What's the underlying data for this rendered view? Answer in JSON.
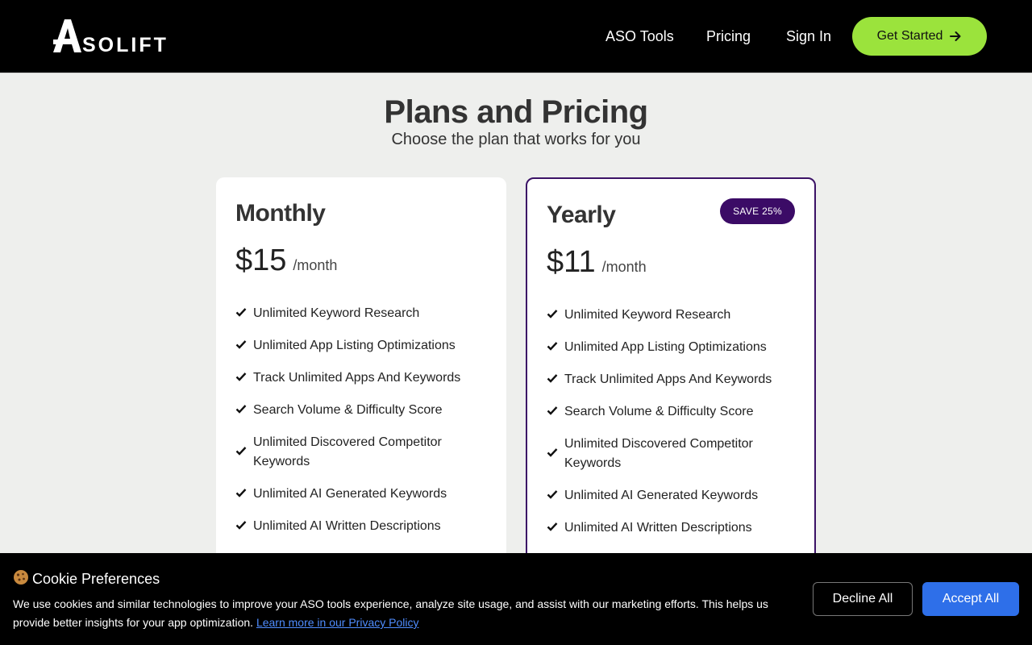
{
  "header": {
    "logo_text": "SOLIFT",
    "nav": [
      {
        "label": "ASO Tools"
      },
      {
        "label": "Pricing"
      },
      {
        "label": "Sign In"
      }
    ],
    "cta_label": "Get Started",
    "cta_icon": "arrow-right-icon"
  },
  "hero": {
    "title": "Plans and Pricing",
    "subtitle": "Choose the plan that works for you"
  },
  "plans": [
    {
      "name": "Monthly",
      "price": "$15",
      "unit": "/month",
      "badge": "",
      "features": [
        "Unlimited Keyword Research",
        "Unlimited App Listing Optimizations",
        "Track Unlimited Apps And Keywords",
        "Search Volume & Difficulty Score",
        "Unlimited Discovered Competitor Keywords",
        "Unlimited AI Generated Keywords",
        "Unlimited AI Written Descriptions"
      ]
    },
    {
      "name": "Yearly",
      "price": "$11",
      "unit": "/month",
      "badge": "SAVE 25%",
      "features": [
        "Unlimited Keyword Research",
        "Unlimited App Listing Optimizations",
        "Track Unlimited Apps And Keywords",
        "Search Volume & Difficulty Score",
        "Unlimited Discovered Competitor Keywords",
        "Unlimited AI Generated Keywords",
        "Unlimited AI Written Descriptions"
      ]
    }
  ],
  "cookie": {
    "icon": "cookie-icon",
    "title": "Cookie Preferences",
    "text": "We use cookies and similar technologies to improve your ASO tools experience, analyze site usage, and assist with our marketing efforts. This helps us provide better insights for your app optimization.",
    "link_label": "Learn more in our Privacy Policy",
    "decline_label": "Decline All",
    "accept_label": "Accept All"
  },
  "colors": {
    "header_bg": "#000000",
    "cta_bg": "#9be33c",
    "badge_bg": "#3b0b66",
    "yearly_border": "#3b1266",
    "accept_bg": "#2e6fe9",
    "link": "#4f8dff",
    "page_bg": "#eeefed"
  }
}
